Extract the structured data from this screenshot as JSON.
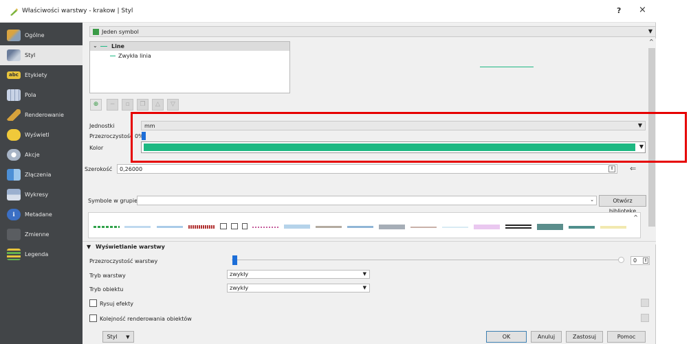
{
  "window": {
    "title": "Właściwości warstwy - krakow | Styl",
    "help_label": "?",
    "close_label": "×"
  },
  "sidebar": {
    "items": [
      {
        "label": "Ogólne",
        "icon": "tools-icon"
      },
      {
        "label": "Styl",
        "icon": "paintbrush-icon"
      },
      {
        "label": "Etykiety",
        "icon": "abc-label-icon"
      },
      {
        "label": "Pola",
        "icon": "table-icon"
      },
      {
        "label": "Renderowanie",
        "icon": "brush-icon"
      },
      {
        "label": "Wyświetl",
        "icon": "speech-bubble-icon"
      },
      {
        "label": "Akcje",
        "icon": "gear-action-icon"
      },
      {
        "label": "Złączenia",
        "icon": "join-icon"
      },
      {
        "label": "Wykresy",
        "icon": "chart-icon"
      },
      {
        "label": "Metadane",
        "icon": "info-icon"
      },
      {
        "label": "Zmienne",
        "icon": "variables-icon"
      },
      {
        "label": "Legenda",
        "icon": "legend-icon"
      }
    ]
  },
  "style": {
    "renderer": "Jeden symbol",
    "tree": {
      "root": "Line",
      "child": "Zwykła linia"
    },
    "unit_label": "Jednostki",
    "unit_value": "mm",
    "opacity_label": "Przezroczystość 0%",
    "color_label": "Kolor",
    "color_value": "#1db882",
    "width_label": "Szerokość",
    "width_value": "0,26000",
    "group_label": "Symbole w grupie",
    "group_value": "",
    "open_library": "Otwórz bibliotekę"
  },
  "layer_rendering": {
    "section_title": "Wyświetlanie warstwy",
    "opacity_label": "Przezroczystość warstwy",
    "opacity_value": "0",
    "blend_layer_label": "Tryb warstwy",
    "blend_layer_value": "zwykły",
    "blend_feature_label": "Tryb obiektu",
    "blend_feature_value": "zwykły",
    "draw_effects_label": "Rysuj efekty",
    "render_order_label": "Kolejność renderowania obiektów"
  },
  "footer": {
    "style_button": "Styl",
    "ok": "OK",
    "cancel": "Anuluj",
    "apply": "Zastosuj",
    "help": "Pomoc"
  },
  "colors": {
    "sidebar_bg": "#424548",
    "selection": "#1db882",
    "highlight": "#e60000",
    "accent": "#1d6ed8"
  }
}
